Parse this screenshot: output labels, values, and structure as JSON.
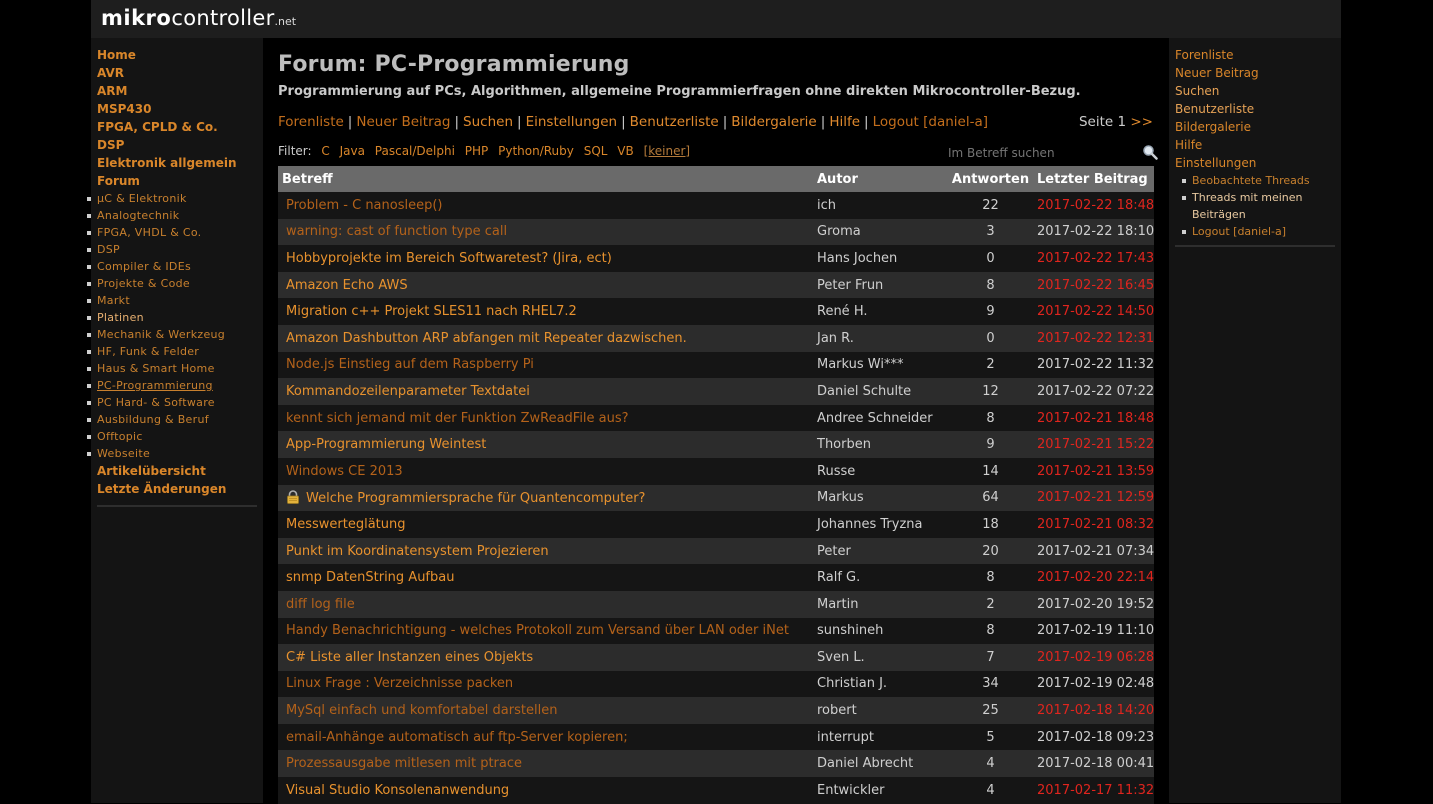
{
  "header": {
    "logo_bold": "mikro",
    "logo_light": "controller",
    "logo_suffix": ".net"
  },
  "left_nav": {
    "top_items": [
      "Home",
      "AVR",
      "ARM",
      "MSP430",
      "FPGA, CPLD & Co.",
      "DSP",
      "Elektronik allgemein",
      "Forum"
    ],
    "forum_items": [
      "µC & Elektronik",
      "Analogtechnik",
      "FPGA, VHDL & Co.",
      "DSP",
      "Compiler & IDEs",
      "Projekte & Code",
      "Markt",
      "Platinen",
      "Mechanik & Werkzeug",
      "HF, Funk & Felder",
      "Haus & Smart Home",
      "PC-Programmierung",
      "PC Hard- & Software",
      "Ausbildung & Beruf",
      "Offtopic",
      "Webseite"
    ],
    "bottom_items": [
      "Artikelübersicht",
      "Letzte Änderungen"
    ]
  },
  "main": {
    "title": "Forum: PC-Programmierung",
    "subtitle": "Programmierung auf PCs, Algorithmen, allgemeine Programmierfragen ohne direkten Mikrocontroller-Bezug.",
    "links": [
      "Forenliste",
      "Neuer Beitrag",
      "Suchen",
      "Einstellungen",
      "Benutzerliste",
      "Bildergalerie",
      "Hilfe",
      "Logout [daniel-a]"
    ],
    "pager": {
      "label": "Seite 1",
      "next": ">>"
    },
    "filter": {
      "label": "Filter:",
      "options": [
        "C",
        "Java",
        "Pascal/Delphi",
        "PHP",
        "Python/Ruby",
        "SQL",
        "VB"
      ],
      "none": "[keiner]"
    },
    "search": {
      "placeholder": "Im Betreff suchen",
      "icon": "magnifier-icon"
    },
    "table": {
      "headers": [
        "Betreff",
        "Autor",
        "Antworten",
        "Letzter Beitrag"
      ],
      "rows": [
        {
          "subject": "Problem - C nanosleep()",
          "author": "ich",
          "answers": "22",
          "date": "2017-02-22 18:48",
          "new": true,
          "visited": true
        },
        {
          "subject": "warning: cast of function type call",
          "author": "Groma",
          "answers": "3",
          "date": "2017-02-22 18:10",
          "new": false,
          "visited": true
        },
        {
          "subject": "Hobbyprojekte im Bereich Softwaretest? (Jira, ect)",
          "author": "Hans Jochen",
          "answers": "0",
          "date": "2017-02-22 17:43",
          "new": true,
          "visited": false
        },
        {
          "subject": "Amazon Echo AWS",
          "author": "Peter Frun",
          "answers": "8",
          "date": "2017-02-22 16:45",
          "new": true,
          "visited": false
        },
        {
          "subject": "Migration c++ Projekt SLES11 nach RHEL7.2",
          "author": "René H.",
          "answers": "9",
          "date": "2017-02-22 14:50",
          "new": true,
          "visited": false
        },
        {
          "subject": "Amazon Dashbutton ARP abfangen mit Repeater dazwischen.",
          "author": "Jan R.",
          "answers": "0",
          "date": "2017-02-22 12:31",
          "new": true,
          "visited": false
        },
        {
          "subject": "Node.js Einstieg auf dem Raspberry Pi",
          "author": "Markus Wi***",
          "answers": "2",
          "date": "2017-02-22 11:32",
          "new": false,
          "visited": true
        },
        {
          "subject": "Kommandozeilenparameter Textdatei",
          "author": "Daniel Schulte",
          "answers": "12",
          "date": "2017-02-22 07:22",
          "new": false,
          "visited": false
        },
        {
          "subject": "kennt sich jemand mit der Funktion ZwReadFile aus?",
          "author": "Andree Schneider",
          "answers": "8",
          "date": "2017-02-21 18:48",
          "new": true,
          "visited": true
        },
        {
          "subject": "App-Programmierung Weintest",
          "author": "Thorben",
          "answers": "9",
          "date": "2017-02-21 15:22",
          "new": true,
          "visited": false
        },
        {
          "subject": "Windows CE 2013",
          "author": "Russe",
          "answers": "14",
          "date": "2017-02-21 13:59",
          "new": true,
          "visited": true
        },
        {
          "subject": "Welche Programmiersprache für Quantencomputer?",
          "author": "Markus",
          "answers": "64",
          "date": "2017-02-21 12:59",
          "new": true,
          "visited": false,
          "locked": true
        },
        {
          "subject": "Messwerteglätung",
          "author": "Johannes Tryzna",
          "answers": "18",
          "date": "2017-02-21 08:32",
          "new": true,
          "visited": false
        },
        {
          "subject": "Punkt im Koordinatensystem Projezieren",
          "author": "Peter",
          "answers": "20",
          "date": "2017-02-21 07:34",
          "new": false,
          "visited": false
        },
        {
          "subject": "snmp DatenString Aufbau",
          "author": "Ralf G.",
          "answers": "8",
          "date": "2017-02-20 22:14",
          "new": true,
          "visited": false
        },
        {
          "subject": "diff log file",
          "author": "Martin",
          "answers": "2",
          "date": "2017-02-20 19:52",
          "new": false,
          "visited": true
        },
        {
          "subject": "Handy Benachrichtigung - welches Protokoll zum Versand über LAN oder iNet",
          "author": "sunshineh",
          "answers": "8",
          "date": "2017-02-19 11:10",
          "new": false,
          "visited": true
        },
        {
          "subject": "C# Liste aller Instanzen eines Objekts",
          "author": "Sven L.",
          "answers": "7",
          "date": "2017-02-19 06:28",
          "new": true,
          "visited": false
        },
        {
          "subject": "Linux Frage : Verzeichnisse packen",
          "author": "Christian J.",
          "answers": "34",
          "date": "2017-02-19 02:48",
          "new": false,
          "visited": true
        },
        {
          "subject": "MySql einfach und komfortabel darstellen",
          "author": "robert",
          "answers": "25",
          "date": "2017-02-18 14:20",
          "new": true,
          "visited": true
        },
        {
          "subject": "email-Anhänge automatisch auf ftp-Server kopieren;",
          "author": "interrupt",
          "answers": "5",
          "date": "2017-02-18 09:23",
          "new": false,
          "visited": true
        },
        {
          "subject": "Prozessausgabe mitlesen mit ptrace",
          "author": "Daniel Abrecht",
          "answers": "4",
          "date": "2017-02-18 00:41",
          "new": false,
          "visited": true
        },
        {
          "subject": "Visual Studio Konsolenanwendung",
          "author": "Entwickler",
          "answers": "4",
          "date": "2017-02-17 11:32",
          "new": true,
          "visited": false
        }
      ]
    }
  },
  "right_nav": {
    "items": [
      "Forenliste",
      "Neuer Beitrag",
      "Suchen",
      "Benutzerliste",
      "Bildergalerie",
      "Hilfe",
      "Einstellungen"
    ],
    "sub_items": [
      "Beobachtete Threads",
      "Threads mit meinen Beiträgen",
      "Logout [daniel-a]"
    ]
  },
  "colors": {
    "link": "#e08a2e",
    "visited_link": "#b4621a",
    "new_post_date": "#e0251e",
    "header_bg": "#1e1e1e",
    "table_header": "#6a6a6a"
  }
}
